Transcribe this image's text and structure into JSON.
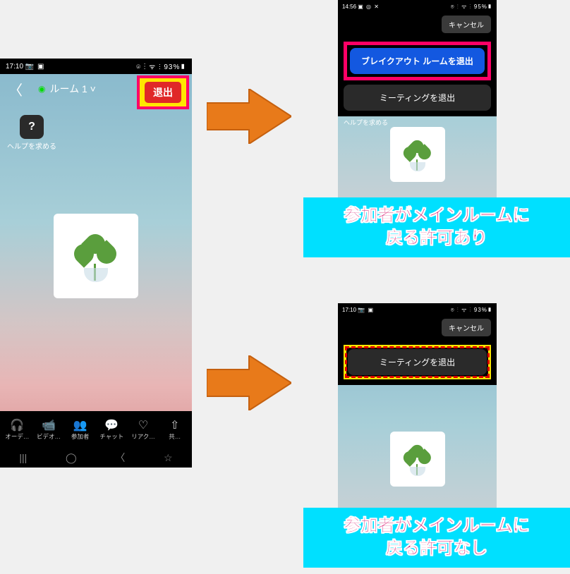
{
  "phones": {
    "p1": {
      "status_time": "17:10",
      "status_left_icons": "📷 ▣",
      "status_right": "⌾ ⋮ ᯤ ⫶ 93%▮",
      "room_title": "ルーム 1 ˅",
      "exit_label": "退出",
      "help_label": "ヘルプを求める",
      "toolbar": {
        "audio": "オーデ…",
        "video": "ビデオ…",
        "participants": "参加者",
        "chat": "チャット",
        "reactions": "リアク…",
        "share": "共…"
      },
      "nav": {
        "recents": "|||",
        "home": "◯",
        "back": "〈",
        "access": "☆"
      }
    },
    "p2": {
      "status_time": "14:56",
      "status_left_icons": "▣ ◎ ✕",
      "status_right": "⌾ ⋮ ᯤ ⫶ 95%▮",
      "cancel": "キャンセル",
      "leave_breakout": "ブレイクアウト ルームを退出",
      "leave_meeting": "ミーティングを退出",
      "help_label": "ヘルプを求める"
    },
    "p3": {
      "status_time": "17:10",
      "status_left_icons": "📷 ▣",
      "status_right": "⌾ ⋮ ᯤ ⫶ 93%▮",
      "cancel": "キャンセル",
      "leave_meeting": "ミーティングを退出"
    }
  },
  "captions": {
    "allowed_line1": "参加者がメインルームに",
    "allowed_line2": "戻る許可あり",
    "denied_line1": "参加者がメインルームに",
    "denied_line2": "戻る許可なし"
  }
}
